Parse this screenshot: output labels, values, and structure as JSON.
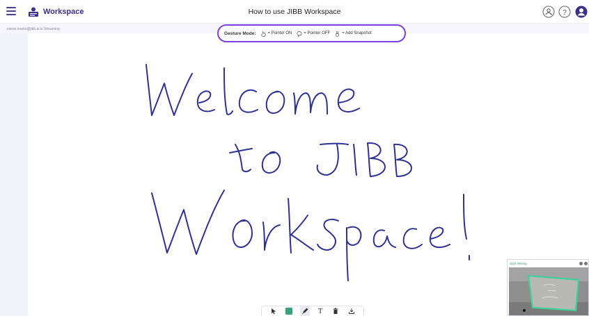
{
  "header": {
    "app_name": "Workspace",
    "document_title": "How to use JIBB Workspace"
  },
  "status_line": "owner.marks@jibb.ai is Streaming",
  "gesture_bar": {
    "label": "Gesture Mode:",
    "pointer_on": "= Pointer ON",
    "pointer_off": "= Pointer OFF",
    "snapshot": "= Add Snapshot"
  },
  "toolbar": {
    "selected_color": "#3aa37a",
    "text_tool_label": "T",
    "tools": [
      "select-arrow-icon",
      "color-swatch",
      "pen-icon",
      "text-icon",
      "delete-icon",
      "download-icon"
    ]
  },
  "camera_preview": {
    "title": "Start Writing"
  },
  "colors": {
    "accent": "#7b3fe4",
    "brand": "#3b2f8a",
    "ink": "#2e3192"
  }
}
